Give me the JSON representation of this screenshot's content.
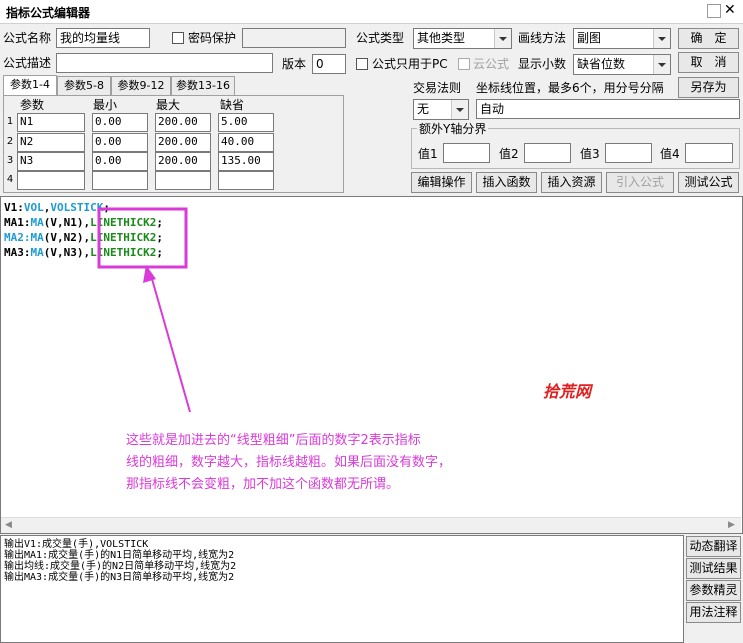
{
  "window": {
    "title": "指标公式编辑器"
  },
  "form": {
    "name_label": "公式名称",
    "name_value": "我的均量线",
    "password_label": "密码保护",
    "type_label": "公式类型",
    "type_value": "其他类型",
    "draw_label": "画线方法",
    "draw_value": "副图",
    "desc_label": "公式描述",
    "desc_value": "",
    "version_label": "版本",
    "version_value": "0",
    "pc_only_label": "公式只用于PC",
    "cloud_label": "云公式",
    "decimals_label": "显示小数",
    "decimals_value": "缺省位数",
    "trade_rule_label": "交易法则",
    "trade_rule_value": "无",
    "axis_pos_label": "坐标线位置，最多6个，用分号分隔",
    "axis_pos_value": "自动",
    "extra_y_label": "额外Y轴分界",
    "val_labels": [
      "值1",
      "值2",
      "值3",
      "值4"
    ]
  },
  "buttons": {
    "ok": "确　定",
    "cancel": "取　消",
    "save_as": "另存为",
    "edit_ops": "编辑操作",
    "insert_func": "插入函数",
    "insert_res": "插入资源",
    "import": "引入公式",
    "test": "测试公式"
  },
  "tabs": [
    "参数1-4",
    "参数5-8",
    "参数9-12",
    "参数13-16"
  ],
  "params": {
    "headers": [
      "参数",
      "最小",
      "最大",
      "缺省"
    ],
    "rows": [
      {
        "num": "1",
        "name": "N1",
        "min": "0.00",
        "max": "200.00",
        "def": "5.00"
      },
      {
        "num": "2",
        "name": "N2",
        "min": "0.00",
        "max": "200.00",
        "def": "40.00"
      },
      {
        "num": "3",
        "name": "N3",
        "min": "0.00",
        "max": "200.00",
        "def": "135.00"
      },
      {
        "num": "4",
        "name": "",
        "min": "",
        "max": "",
        "def": ""
      }
    ]
  },
  "code": {
    "line1": {
      "a": "V1:",
      "b": "VOL",
      "c": ",",
      "d": "VOLSTICK",
      "e": ";"
    },
    "line2": {
      "a": "MA1:",
      "b": "MA",
      "c": "(V,N1),",
      "d": "LINETHICK2",
      "e": ";"
    },
    "line3": {
      "a": "MA2:",
      "b": "MA",
      "c": "(V,N2),",
      "d": "LINETHICK2",
      "e": ";"
    },
    "line4": {
      "a": "MA3:",
      "b": "MA",
      "c": "(V,N3),",
      "d": "LINETHICK2",
      "e": ";"
    }
  },
  "annotation": {
    "line1": "这些就是加进去的“线型粗细”后面的数字2表示指标",
    "line2": "线的粗细，数字越大，指标线越粗。如果后面没有数字，",
    "line3": "那指标线不会变粗，加不加这个函数都无所谓。",
    "watermark": "拾荒网"
  },
  "output": [
    "输出V1:成交量(手),VOLSTICK",
    "输出MA1:成交量(手)的N1日简单移动平均,线宽为2",
    "输出均线:成交量(手)的N2日简单移动平均,线宽为2",
    "输出MA3:成交量(手)的N3日简单移动平均,线宽为2"
  ],
  "side_buttons": [
    "动态翻译",
    "测试结果",
    "参数精灵",
    "用法注释"
  ],
  "colors": {
    "annotation": "#d93ad8",
    "code_blue": "#1f9bd3",
    "code_green": "#1a8a1a",
    "watermark": "#e02020"
  }
}
